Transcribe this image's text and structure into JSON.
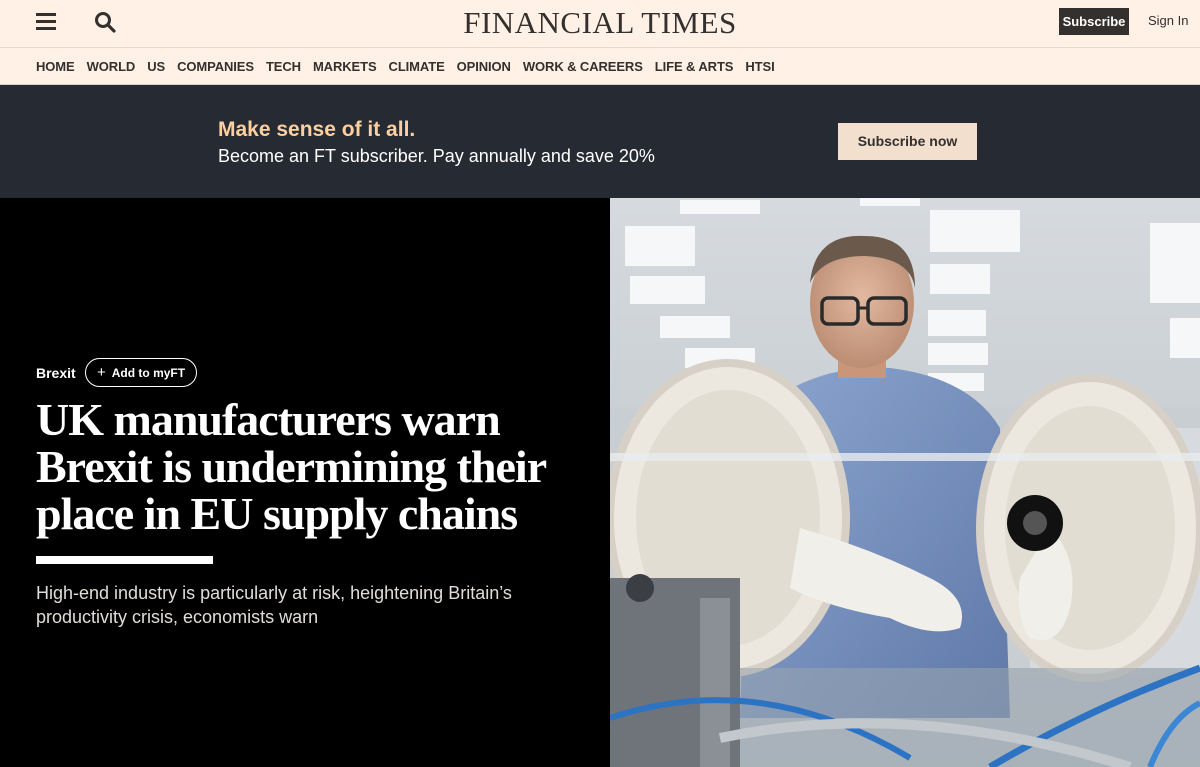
{
  "header": {
    "masthead": "FINANCIAL TIMES",
    "subscribe_label": "Subscribe",
    "signin_label": "Sign In",
    "icons": {
      "menu": "hamburger-menu-icon",
      "search": "search-icon"
    }
  },
  "nav": {
    "items": [
      {
        "label": "HOME"
      },
      {
        "label": "WORLD"
      },
      {
        "label": "US"
      },
      {
        "label": "COMPANIES"
      },
      {
        "label": "TECH"
      },
      {
        "label": "MARKETS"
      },
      {
        "label": "CLIMATE"
      },
      {
        "label": "OPINION"
      },
      {
        "label": "WORK & CAREERS"
      },
      {
        "label": "LIFE & ARTS"
      },
      {
        "label": "HTSI"
      }
    ]
  },
  "promo": {
    "headline": "Make sense of it all.",
    "subline": "Become an FT subscriber. Pay annually and save 20%",
    "button_label": "Subscribe now"
  },
  "article": {
    "topic": "Brexit",
    "myft_label": "Add to myFT",
    "headline": "UK manufacturers warn Brexit is undermining their place in EU supply chains",
    "standfirst": "High-end industry is particularly at risk, heightening Britain’s productivity crisis, economists warn"
  },
  "colors": {
    "background": "#fff1e5",
    "promo_bg": "#262a33",
    "promo_accent": "#fcd0a1",
    "hero_bg": "#000000"
  }
}
